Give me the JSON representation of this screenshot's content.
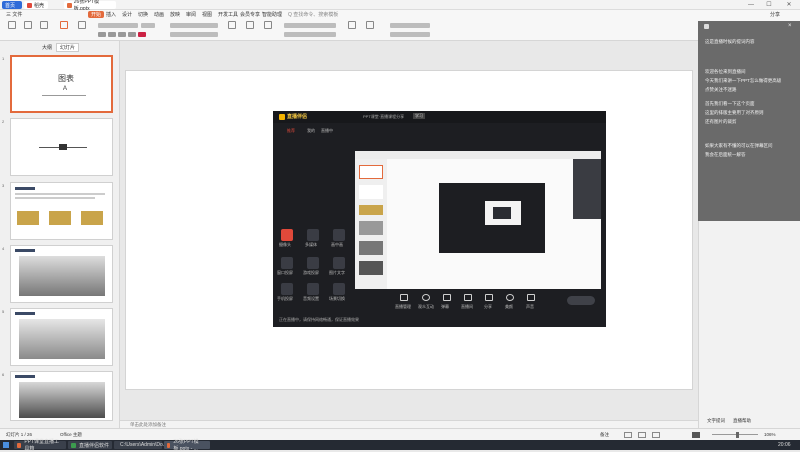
{
  "titlebar": {
    "tabs": [
      {
        "label": "首页",
        "color": "#2f6bd8"
      },
      {
        "label": "稻壳",
        "color": "#e0493a"
      },
      {
        "label": "26张PPT模板.pptx",
        "color": "#e36a3c"
      }
    ],
    "controls": [
      "—",
      "☐",
      "✕"
    ]
  },
  "menubar": {
    "items": [
      "三 文件",
      "开始",
      "插入",
      "设计",
      "切换",
      "动画",
      "放映",
      "审阅",
      "视图",
      "开发工具",
      "会员专享",
      "智能助理"
    ],
    "active": "开始",
    "search_placeholder": "Q 查找命令、搜索模板",
    "share_label": "分享"
  },
  "left_panel": {
    "tabs": [
      "大纲",
      "幻灯片"
    ],
    "slides": [
      "1",
      "2",
      "3",
      "4",
      "5",
      "6"
    ],
    "slide1_title": "图表",
    "slide1_sub": "Ａ"
  },
  "video_window": {
    "title": "PPT课堂·直播课程分享",
    "badge": "学习",
    "app_name": "直播伴侣",
    "left_tabs": [
      "推荐",
      "我的",
      "直播中"
    ],
    "left_buttons": [
      {
        "label": "摄像头",
        "color": "#e0493a"
      },
      {
        "label": "多媒体",
        "color": "#3a3c44"
      },
      {
        "label": "画中画",
        "color": "#3a3c44"
      },
      {
        "label": "窗口投屏",
        "color": "#3a3c44"
      },
      {
        "label": "游戏投屏",
        "color": "#3a3c44"
      },
      {
        "label": "图片文字",
        "color": "#3a3c44"
      },
      {
        "label": "手机投屏",
        "color": "#3a3c44"
      },
      {
        "label": "音频设置",
        "color": "#3a3c44"
      },
      {
        "label": "场景切换",
        "color": "#3a3c44"
      }
    ],
    "controls": [
      "直播管理",
      "观众互动",
      "弹幕",
      "直播间",
      "分享",
      "美颜",
      "声音"
    ],
    "status_text": "正在直播中，请保持网络畅通，保证直播效果"
  },
  "notes_placeholder": "单击此处添加备注",
  "right_panel": {
    "lines": [
      "这是直播时候的提词内容",
      "",
      "欢迎各位来到直播间",
      "今天我们来讲一下PPT怎么做得更高级",
      "点赞关注不迷路",
      "",
      "首先我们看一下这个页面",
      "这里的排版主要用了对齐原则",
      "还有图片的裁剪",
      "",
      "如果大家有不懂的可以在弹幕区问",
      "我会在后面统一解答"
    ],
    "bottom_tabs": [
      "文字提词",
      "直播帮助"
    ]
  },
  "statusbar": {
    "slide_counter": "幻灯片 1 / 26",
    "theme": "Office 主题",
    "notes_toggle": "备注",
    "zoom": "106%"
  },
  "taskbar": {
    "items": [
      {
        "label": "PPT课堂直播工具箱",
        "color": "#e36a3c"
      },
      {
        "label": "直播伴侣软件",
        "color": "#3c9b4e"
      },
      {
        "label": "C:\\Users\\Admin\\Do...",
        "color": "#e0b43a"
      },
      {
        "label": "26张PPT模板.pptx - ...",
        "color": "#e36a3c"
      }
    ],
    "clock": "20:06"
  }
}
